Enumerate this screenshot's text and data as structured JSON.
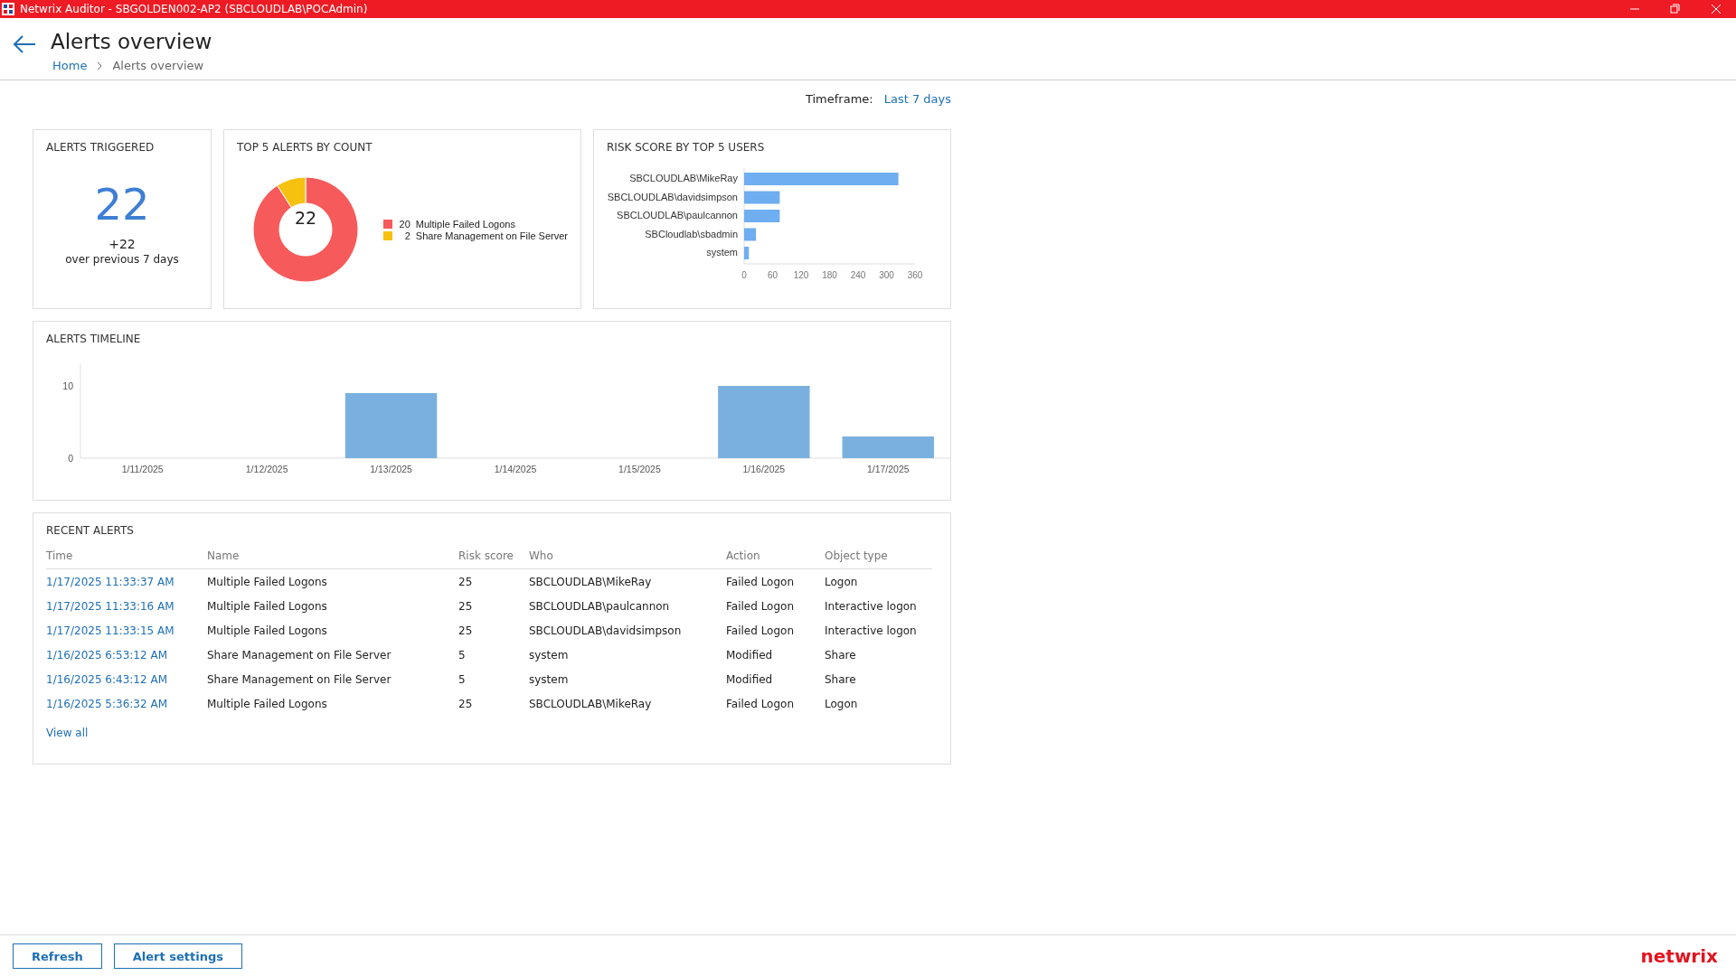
{
  "window": {
    "title": "Netwrix Auditor - SBGOLDEN002-AP2 (SBCLOUDLAB\\POCAdmin)"
  },
  "header": {
    "title": "Alerts overview",
    "breadcrumb": [
      {
        "label": "Home",
        "kind": "link"
      },
      {
        "label": "Alerts overview",
        "kind": "current"
      }
    ]
  },
  "timeframe": {
    "label": "Timeframe:",
    "value": "Last 7 days"
  },
  "alerts_triggered": {
    "title": "ALERTS TRIGGERED",
    "count": "22",
    "change": "+22",
    "change_caption": "over previous 7 days"
  },
  "top_alerts": {
    "title": "TOP 5 ALERTS BY COUNT",
    "total": "22",
    "legend": [
      {
        "count": "20",
        "color": "#f75a5a"
      },
      {
        "count": "2",
        "color": "#f7c10f"
      }
    ],
    "chart_data": {
      "type": "donut",
      "categories": [
        "Multiple Failed Logons",
        "Share Management on File Server"
      ],
      "values": [
        90.91,
        9.09
      ]
    }
  },
  "risk_score": {
    "title": "RISK SCORE BY TOP 5 USERS",
    "chart_data": {
      "type": "bar",
      "orientation": "horizontal",
      "categories": [
        "SBCLOUDLAB\\MikeRay",
        "SBCLOUDLAB\\davidsimpson",
        "SBCLOUDLAB\\paulcannon",
        "SBCloudlab\\sbadmin",
        "system"
      ],
      "values": [
        325,
        75,
        75,
        25,
        10
      ],
      "xlim": [
        0,
        360
      ],
      "xticks": [
        0,
        60,
        120,
        180,
        240,
        300,
        360
      ]
    }
  },
  "timeline": {
    "title": "ALERTS TIMELINE",
    "chart_data": {
      "type": "bar",
      "categories": [
        "1/11/2025",
        "1/12/2025",
        "1/13/2025",
        "1/14/2025",
        "1/15/2025",
        "1/16/2025",
        "1/17/2025"
      ],
      "values": [
        0,
        0,
        9,
        0,
        0,
        10,
        3
      ],
      "ylim": [
        0,
        13
      ],
      "yticks": [
        0,
        10
      ]
    }
  },
  "recent_alerts": {
    "title": "RECENT ALERTS",
    "columns": [
      "Time",
      "Name",
      "Risk score",
      "Who",
      "Action",
      "Object type"
    ],
    "rows": [
      [
        "1/17/2025 11:33:37 AM",
        "Multiple Failed Logons",
        "25",
        "SBCLOUDLAB\\MikeRay",
        "Failed Logon",
        "Logon"
      ],
      [
        "1/17/2025 11:33:16 AM",
        "Multiple Failed Logons",
        "25",
        "SBCLOUDLAB\\paulcannon",
        "Failed Logon",
        "Interactive logon"
      ],
      [
        "1/17/2025 11:33:15 AM",
        "Multiple Failed Logons",
        "25",
        "SBCLOUDLAB\\davidsimpson",
        "Failed Logon",
        "Interactive logon"
      ],
      [
        "1/16/2025 6:53:12 AM",
        "Share Management on File Server",
        "5",
        "system",
        "Modified",
        "Share"
      ],
      [
        "1/16/2025 6:43:12 AM",
        "Share Management on File Server",
        "5",
        "system",
        "Modified",
        "Share"
      ],
      [
        "1/16/2025 5:36:32 AM",
        "Multiple Failed Logons",
        "25",
        "SBCLOUDLAB\\MikeRay",
        "Failed Logon",
        "Logon"
      ]
    ],
    "view_all": "View all"
  },
  "buttons": [
    "Refresh",
    "Alert settings"
  ],
  "logo": "netwrix"
}
